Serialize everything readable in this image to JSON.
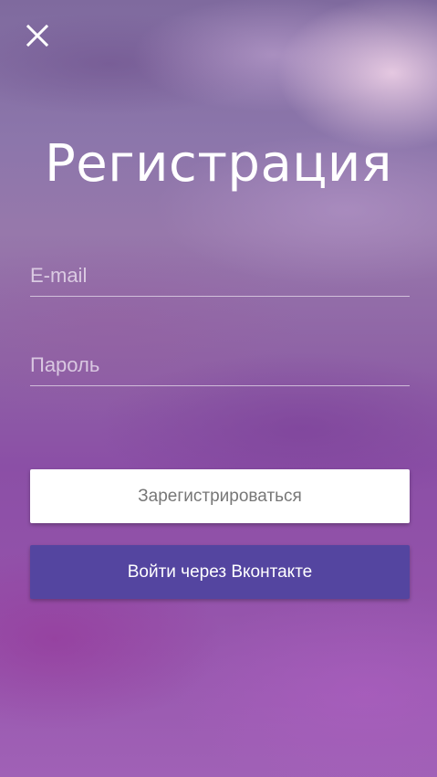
{
  "close_button": {
    "icon": "close-icon"
  },
  "title": "Регистрация",
  "form": {
    "email_placeholder": "E-mail",
    "email_value": "",
    "password_placeholder": "Пароль",
    "password_value": ""
  },
  "buttons": {
    "register_label": "Зарегистрироваться",
    "vk_label": "Войти через Вконтакте"
  },
  "colors": {
    "vk_button": "#5445a0",
    "register_button": "#ffffff"
  }
}
